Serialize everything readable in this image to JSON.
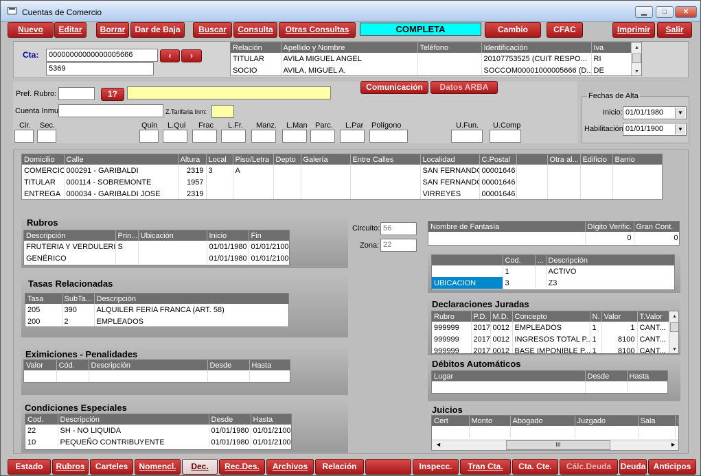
{
  "window": {
    "title": "Cuentas de Comercio"
  },
  "toolbar": {
    "nuevo": "Nuevo",
    "editar": "Editar",
    "borrar": "Borrar",
    "dar_baja": "Dar de Baja",
    "buscar": "Buscar",
    "consulta": "Consulta",
    "otras": "Otras Consultas",
    "status": "COMPLETA",
    "cambio": "Cambio",
    "cfac": "CFAC",
    "imprimir": "Imprimir",
    "salir": "Salir"
  },
  "cuenta": {
    "label": "Cta:",
    "value": "00000000000000005666",
    "sub": "5369"
  },
  "relaciones": {
    "headers": [
      "Relación",
      "Apellido y Nombre",
      "Teléfono",
      "Identificación",
      "Iva"
    ],
    "rows": [
      [
        "TITULAR",
        "AVILA MIGUEL ANGEL",
        "",
        "20107753525 (CUIT  RESPO...",
        "RI"
      ],
      [
        "SOCIO",
        "AVILA, MIGUEL A.",
        "",
        "SOCCOM00001000005666 (D...",
        "DE"
      ]
    ]
  },
  "rubro": {
    "pref_label": "Pref. Rubro:",
    "btn": "1?",
    "cuenta_inmu": "Cuenta Inmu:",
    "ztar": "Z.Tarifaria Inm:"
  },
  "buttons": {
    "comunicacion": "Comunicación",
    "arba": "Datos ARBA"
  },
  "fechas": {
    "legend": "Fechas de Alta",
    "inicio_label": "Inicio:",
    "inicio": "01/01/1980",
    "hab_label": "Habilitación:",
    "hab": "01/01/1900"
  },
  "catastro": [
    "Cir.",
    "Sec.",
    "Quin",
    "L.Qui",
    "Frac",
    "L.Fr.",
    "Manz.",
    "L.Man",
    "Parc.",
    "L.Par",
    "Polígono",
    "U.Fun.",
    "U.Comp"
  ],
  "domicilios": {
    "headers": [
      "Domicilio",
      "Calle",
      "Altura",
      "Local",
      "Piso/Letra",
      "Depto",
      "Galería",
      "Entre Calles",
      "Localidad",
      "C.Postal",
      "",
      "Otra al...",
      "Edificio",
      "Barrio"
    ],
    "rows": [
      [
        "COMERCIO",
        "000291 - GARIBALDI",
        "2319",
        "3",
        "A",
        "",
        "",
        "",
        "SAN FERNANDO",
        "00001646",
        "",
        "",
        "",
        ""
      ],
      [
        "TITULAR",
        "000114 - SOBREMONTE",
        "1957",
        "",
        "",
        "",
        "",
        "",
        "SAN FERNANDO",
        "00001646",
        "",
        "",
        "",
        ""
      ],
      [
        "ENTREGA",
        "000034 - GARIBALDI JOSE",
        "2319",
        "",
        "",
        "",
        "",
        "",
        "VIRREYES",
        "00001646",
        "",
        "",
        "",
        ""
      ]
    ]
  },
  "rubros": {
    "title": "Rubros",
    "headers": [
      "Descripción",
      "Prin...",
      "Ubicación",
      "Inicio",
      "Fin"
    ],
    "rows": [
      [
        "FRUTERIA Y VERDULERIA",
        "S",
        "",
        "01/01/1980",
        "01/01/2100"
      ],
      [
        "GENÉRICO",
        "",
        "",
        "01/01/1980",
        "01/01/2100"
      ]
    ]
  },
  "circuito": {
    "label": "Circuito:",
    "value": "56",
    "zona_label": "Zona:",
    "zona": "22"
  },
  "fantasia": {
    "headers": [
      "Nombre de Fantasía",
      "Dígito Verific.",
      "Gran Cont."
    ],
    "row": [
      "",
      "0",
      "0"
    ]
  },
  "codigos": {
    "headers": [
      "",
      "Cod.",
      "...",
      "Descripción"
    ],
    "rows": [
      [
        "",
        "1",
        "",
        "ACTIVO"
      ],
      [
        "UBICACION",
        "3",
        "",
        "Z3"
      ]
    ]
  },
  "tasas": {
    "title": "Tasas Relacionadas",
    "headers": [
      "Tasa",
      "SubTa...",
      "Descripción"
    ],
    "rows": [
      [
        "205",
        "390",
        "ALQUILER FERIA FRANCA (ART. 58)"
      ],
      [
        "200",
        "2",
        "EMPLEADOS"
      ]
    ]
  },
  "ddjj": {
    "title": "Declaraciones Juradas",
    "headers": [
      "Rubro",
      "P.D.",
      "M.D.",
      "Concepto",
      "N.",
      "Valor",
      "T.Valor"
    ],
    "rows": [
      [
        "999999",
        "2017",
        "0012",
        "EMPLEADOS",
        "1",
        "1",
        "CANT..."
      ],
      [
        "999999",
        "2017",
        "0012",
        "INGRESOS TOTAL P...",
        "1",
        "8100",
        "CANT..."
      ],
      [
        "999999",
        "2017",
        "0012",
        "BASE IMPONIBLE P...",
        "1",
        "8100",
        "CANT..."
      ]
    ]
  },
  "eximiciones": {
    "title": "Eximiciones - Penalidades",
    "headers": [
      "Valor",
      "Cód.",
      "Descripción",
      "Desde",
      "Hasta"
    ]
  },
  "debitos": {
    "title": "Débitos Automáticos",
    "headers": [
      "Lugar",
      "Desde",
      "Hasta"
    ]
  },
  "condiciones": {
    "title": "Condiciones Especiales",
    "headers": [
      "Cod.",
      "Descripción",
      "Desde",
      "Hasta"
    ],
    "rows": [
      [
        "22",
        "SH - NO LIQUIDA",
        "01/01/1980",
        "01/01/2100"
      ],
      [
        "10",
        "PEQUEÑO CONTRIBUYENTE",
        "01/01/1980",
        "01/01/2100"
      ]
    ]
  },
  "juicios": {
    "title": "Juicios",
    "headers": [
      "Cert",
      "Monto",
      "Abogado",
      "Juzgado",
      "Sala",
      "S"
    ],
    "scroll_mid": "III"
  },
  "bottom": {
    "estado": "Estado",
    "rubros": "Rubros",
    "carteles": "Carteles",
    "nomencl": "Nomencl.",
    "dec": "Dec.",
    "recdes": "Rec.Des.",
    "archivos": "Archivos",
    "relacion": "Relación",
    "inspecc": "Inspecc.",
    "trancta": "Tran Cta.",
    "ctacte": "Cta. Cte.",
    "calc": "Cálc.Deuda",
    "deuda": "Deuda",
    "anticipos": "Anticipos"
  }
}
